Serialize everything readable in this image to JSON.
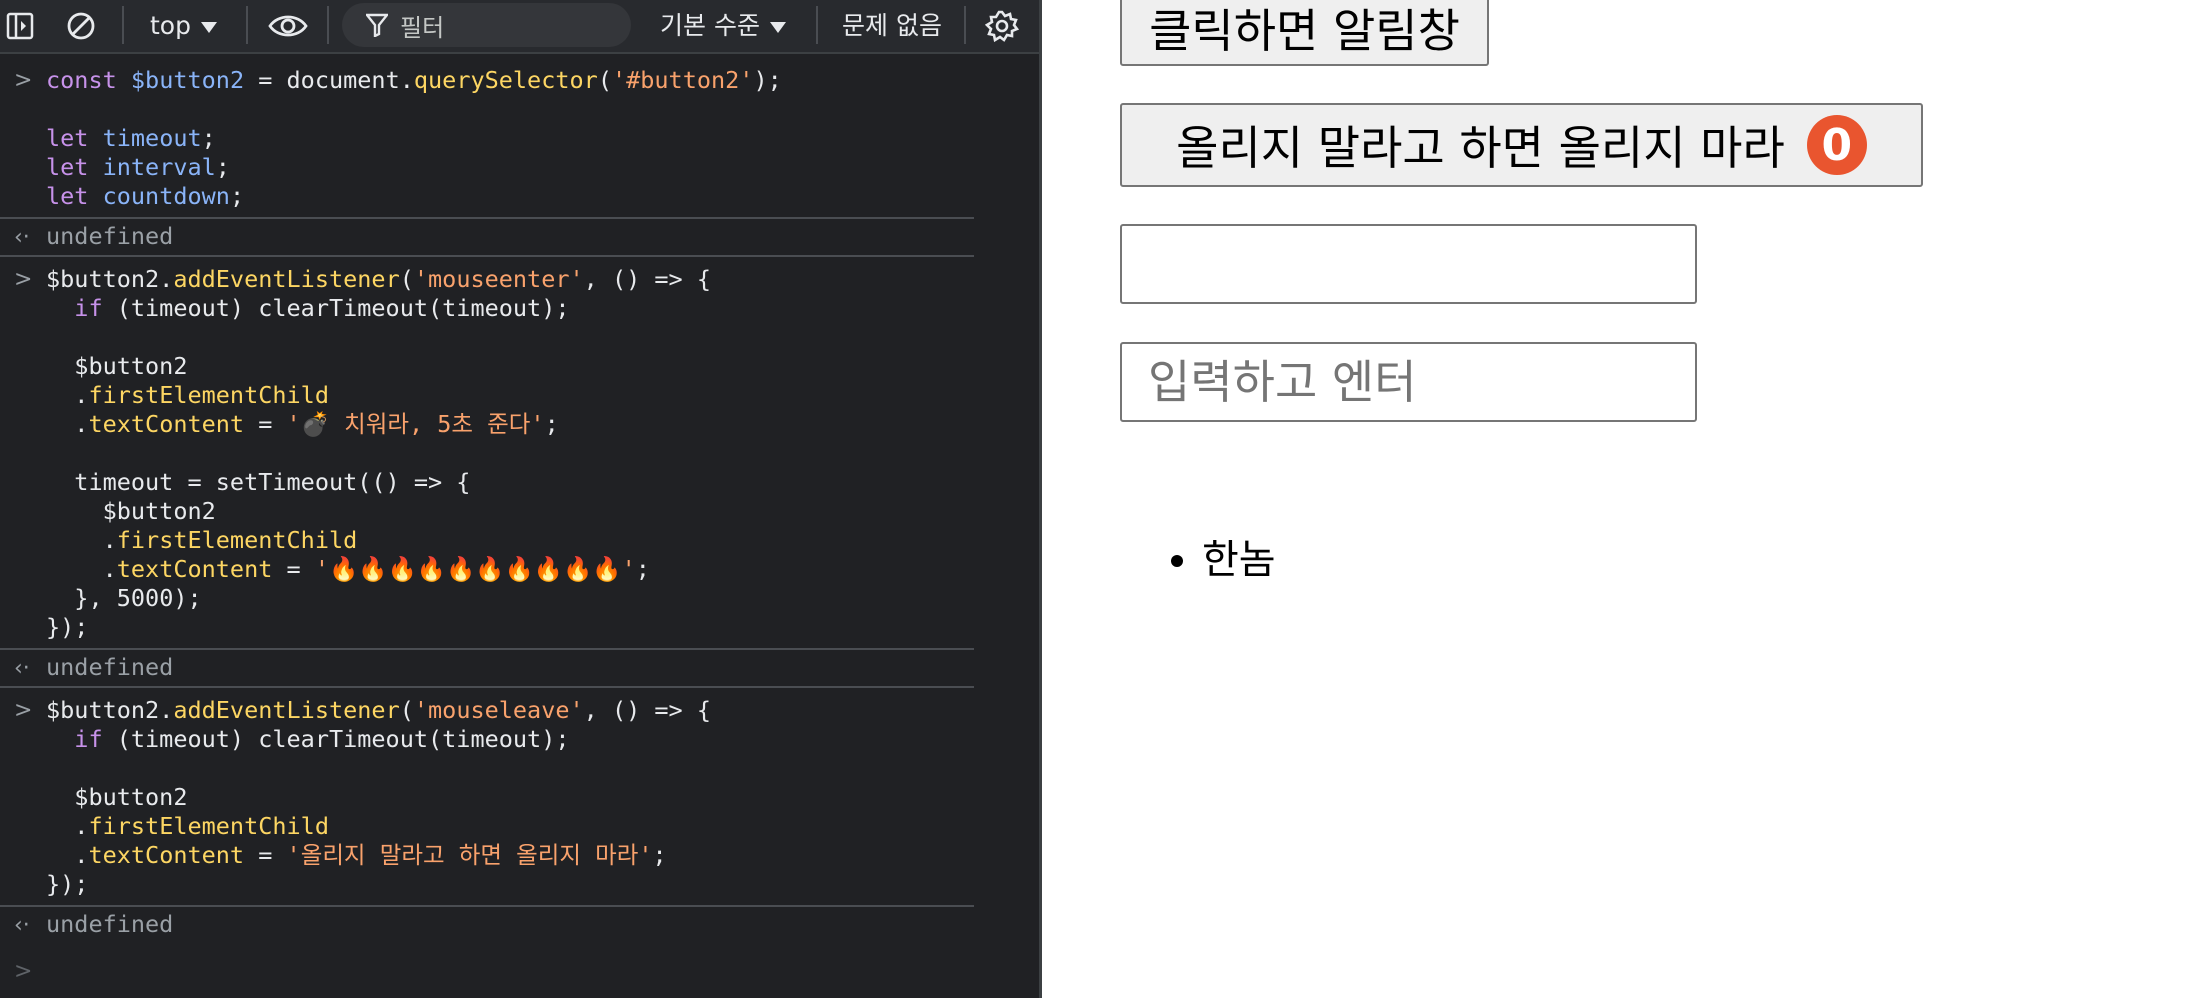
{
  "devtools": {
    "toolbar": {
      "context": "top",
      "filter_placeholder": "필터",
      "levels": "기본 수준",
      "issues": "문제 없음"
    },
    "console": {
      "result_text": "undefined",
      "entries": [
        {
          "code": "const $button2 = document.querySelector('#button2');\n\nlet timeout;\nlet interval;\nlet countdown;",
          "result": "undefined"
        },
        {
          "code": "$button2.addEventListener('mouseenter', () => {\n  if (timeout) clearTimeout(timeout);\n\n  $button2\n  .firstElementChild\n  .textContent = '💣 치워라, 5초 준다';\n\n  timeout = setTimeout(() => {\n    $button2\n    .firstElementChild\n    .textContent = '🔥🔥🔥🔥🔥🔥🔥🔥🔥🔥';\n  }, 5000);\n});",
          "result": "undefined"
        },
        {
          "code": "$button2.addEventListener('mouseleave', () => {\n  if (timeout) clearTimeout(timeout);\n\n  $button2\n  .firstElementChild\n  .textContent = '올리지 말라고 하면 올리지 마라';\n});",
          "result": "undefined"
        }
      ]
    }
  },
  "page": {
    "button1_label": "클릭하면 알림창",
    "button2_label": "올리지 말라고 하면 올리지 마라",
    "button2_badge": "0",
    "input1_value": "",
    "input2_placeholder": "입력하고 엔터",
    "list_items": [
      "한놈"
    ]
  },
  "colors": {
    "devtools_bg": "#202124",
    "badge": "#e9552f",
    "keyword": "#c792ea",
    "variable": "#8ab4f8",
    "string": "#f9a26c",
    "method": "#fdd663"
  }
}
